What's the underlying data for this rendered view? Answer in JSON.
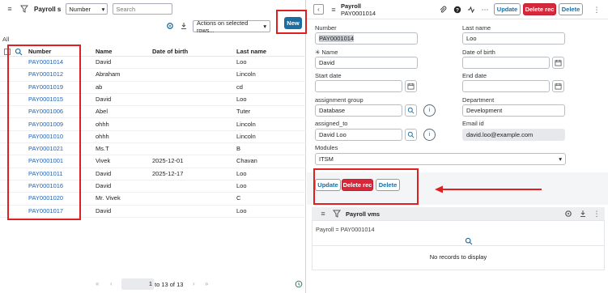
{
  "left": {
    "title": "Payroll s",
    "search_field": "Number",
    "search_placeholder": "Search",
    "actions_label": "Actions on selected rows...",
    "new_label": "New",
    "all_label": "All",
    "columns": [
      "Number",
      "Name",
      "Date of birth",
      "Last name"
    ],
    "rows": [
      {
        "number": "PAY0001014",
        "name": "David",
        "dob": "",
        "last": "Loo"
      },
      {
        "number": "PAY0001012",
        "name": "Abraham",
        "dob": "",
        "last": "Lincoln"
      },
      {
        "number": "PAY0001019",
        "name": "ab",
        "dob": "",
        "last": "cd"
      },
      {
        "number": "PAY0001015",
        "name": "David",
        "dob": "",
        "last": "Loo"
      },
      {
        "number": "PAY0001006",
        "name": "Abel",
        "dob": "",
        "last": "Tuter"
      },
      {
        "number": "PAY0001009",
        "name": "ohhh",
        "dob": "",
        "last": "Lincoln"
      },
      {
        "number": "PAY0001010",
        "name": "ohhh",
        "dob": "",
        "last": "Lincoln"
      },
      {
        "number": "PAY0001021",
        "name": "Ms.T",
        "dob": "",
        "last": "B"
      },
      {
        "number": "PAY0001001",
        "name": "Vivek",
        "dob": "2025-12-01",
        "last": "Chavan"
      },
      {
        "number": "PAY0001011",
        "name": "David",
        "dob": "2025-12-17",
        "last": "Loo"
      },
      {
        "number": "PAY0001016",
        "name": "David",
        "dob": "",
        "last": "Loo"
      },
      {
        "number": "PAY0001020",
        "name": "Mr. Vivek",
        "dob": "",
        "last": "C"
      },
      {
        "number": "PAY0001017",
        "name": "David",
        "dob": "",
        "last": "Loo"
      }
    ],
    "page_value": "1",
    "page_text": "to 13 of 13"
  },
  "right": {
    "title": "Payroll",
    "record": "PAY0001014",
    "update_label": "Update",
    "delete_label": "Delete rec",
    "delete_short_label": "Delete",
    "fields": {
      "number_label": "Number",
      "number_value": "PAY0001014",
      "lastname_label": "Last name",
      "lastname_value": "Loo",
      "name_label": "Name",
      "name_value": "David",
      "required_mark": "✳",
      "dob_label": "Date of birth",
      "start_label": "Start date",
      "end_label": "End date",
      "group_label": "assignment group",
      "group_value": "Database",
      "dept_label": "Department",
      "dept_value": "Development",
      "assigned_label": "assigned_to",
      "assigned_value": "David Loo",
      "email_label": "Email id",
      "email_value": "david.loo@example.com",
      "modules_label": "Modules",
      "modules_value": "ITSM"
    },
    "related": {
      "title": "Payroll vms",
      "filter": "Payroll = PAY0001014",
      "empty": "No records to display"
    }
  },
  "colors": {
    "accent": "#1b6e9f",
    "danger": "#d6283a",
    "annotation": "#e02020",
    "link": "#1f62b3"
  }
}
